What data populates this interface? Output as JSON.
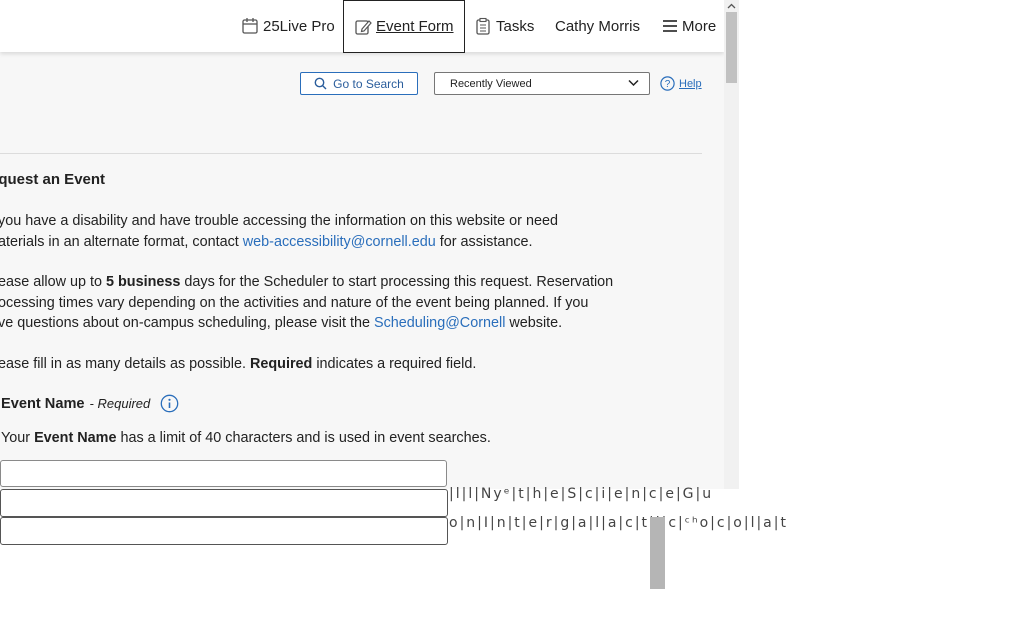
{
  "topbar": {
    "items": [
      {
        "label": "25Live Pro",
        "icon": "calendar-icon"
      },
      {
        "label": "Event Form",
        "icon": "edit-icon",
        "active": true
      },
      {
        "label": "Tasks",
        "icon": "clipboard-icon"
      },
      {
        "label": "Cathy Morris"
      },
      {
        "label": "More",
        "icon": "hamburger-icon"
      }
    ]
  },
  "toolbar": {
    "search_label": "Go to Search",
    "recent_label": "Recently Viewed",
    "help_label": "Help"
  },
  "content": {
    "title": "equest an Event",
    "p1_a": "you have a disability and have trouble accessing the information on this website or need",
    "p1_b": "aterials in an alternate format, contact ",
    "p1_link": "web-accessibility@cornell.edu",
    "p1_c": " for assistance.",
    "p2_a": "ease allow up to ",
    "p2_bold": "5 business",
    "p2_b": " days for the Scheduler to start processing this request. Reservation",
    "p2_c": "ocessing times vary depending on the activities and nature of the event being planned. If you",
    "p2_d": "ve questions about on-campus scheduling, please visit the ",
    "p2_link": "Scheduling@Cornell",
    "p2_e": " website.",
    "p3_a": "ease fill in as many details as possible. ",
    "p3_bold": "Required",
    "p3_b": " indicates a required field.",
    "field_label": "Event Name",
    "field_required": "- Required",
    "hint_a": "Your ",
    "hint_bold": "Event Name",
    "hint_b": " has a limit of 40 characters and is used in event searches."
  },
  "overflow": {
    "line1": "|l|l|Nyᵉ|t|h|e|S|c|i|e|n|c|e|G|u",
    "line2": "o|n|I|n|t|e|r|g|a|l|a|c|t|i|c|ᶜʰo|c|o|l|a|t"
  },
  "colors": {
    "accent": "#2a6ebb",
    "background": "#f7f7f7"
  }
}
